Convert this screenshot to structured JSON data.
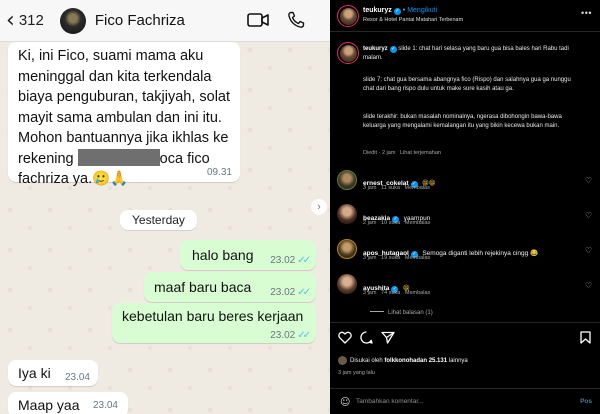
{
  "whatsapp": {
    "header": {
      "back_glyph": "‹",
      "unread_count": "312",
      "contact_name": "Fico Fachriza",
      "icons": [
        "video-call-icon",
        "voice-call-icon"
      ]
    },
    "incoming_message": {
      "line1": "Ki, ini Fico, suami mama aku",
      "line2": "meninggal dan kita terkendala",
      "line3": "biaya penguburan, takjiyah, solat",
      "line4": "mayit sama ambulan dan ini itu.",
      "line5": "Mohon bantuannya jika ikhlas ke",
      "line6_start": "rekening",
      "line6_end": "oca fico",
      "line7": "fachriza ya.",
      "emojis": "🥲🙏",
      "time": "09.31"
    },
    "date_divider": "Yesterday",
    "outgoing": [
      {
        "text": "halo bang",
        "time": "23.02"
      },
      {
        "text": "maaf baru baca",
        "time": "23.02"
      },
      {
        "text": "kebetulan baru beres kerjaan",
        "time": "23.02"
      }
    ],
    "incoming_replies": [
      {
        "text": "Iya ki",
        "time": "23.04"
      },
      {
        "text": "Maap yaa",
        "time": "23.04"
      }
    ],
    "ticks": "✓✓"
  },
  "instagram": {
    "header": {
      "username": "teukuryz",
      "follow_label": "Mengikuti",
      "location": "Resor & Hotel Pantai Matahari Terbenam",
      "more": "•••"
    },
    "caption": {
      "username": "teukuryz",
      "p1": "slide 1: chat hari selasa yang baru gua bisa bales hari Rabu tadi malam.",
      "p2": "slide 7: chat gua bersama abangnya fico (Rispo) dan salahnya gua ga nunggu chat dari bang rispo dulu untuk make sure kasih atau ga.",
      "p3": "slide terakhir: bukan masalah nominalnya, ngerasa dibohongin bawa-bawa keluarga yang mengalami kemalangan itu yang bikin kecewa bukan main.",
      "edited": "Diedit",
      "time": "2 jam",
      "see_translation": "Lihat terjemahan"
    },
    "comments": [
      {
        "user": "ernest_cokelat",
        "text": "😁😁",
        "time": "3 jam",
        "likes": "11 suka",
        "reply": "Membalas"
      },
      {
        "user": "beazakia",
        "text": "yaampun",
        "time": "2 jam",
        "likes": "10 suka",
        "reply": "Membalas"
      },
      {
        "user": "apos_hutagaol",
        "text": "Semoga diganti lebih rejekinya cingg 😂",
        "time": "3 jam",
        "likes": "19 suka",
        "reply": "Membalas"
      },
      {
        "user": "ayushita",
        "text": "😁",
        "time": "3 jam",
        "likes": "74 suka",
        "reply": "Membalas"
      }
    ],
    "view_replies": "Lihat balasan (1)",
    "likes": {
      "prefix": "Disukai oleh ",
      "user": "folkkonohadan",
      "count": "25.131",
      "suffix": " lainnya"
    },
    "post_time": "3 jam yang lalu",
    "comment_placeholder": "Tambahkan komentar...",
    "post_label": "Pos",
    "colors": {
      "verified": "#0095f6",
      "story_ring": "#e1306c",
      "wa_outgoing": "#d9fdd3",
      "wa_ticks": "#53bdeb"
    }
  }
}
